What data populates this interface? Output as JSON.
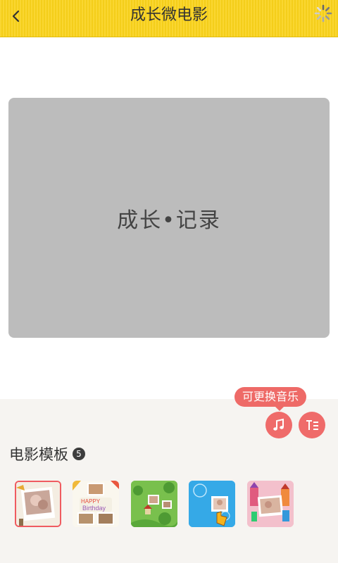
{
  "header": {
    "title": "成长微电影",
    "back_icon": "chevron-left-icon",
    "loading_icon": "spinner-icon",
    "background_color": "#f9d21a"
  },
  "preview": {
    "text": "成长•记录",
    "background_color": "#bcbcbc"
  },
  "controls": {
    "tooltip_text": "可更换音乐",
    "music_icon": "music-note-icon",
    "text_icon": "text-format-icon",
    "accent_color": "#ef6b6a"
  },
  "templates": {
    "title": "电影模板",
    "count": "5",
    "items": [
      {
        "name": "template-baby-photo",
        "selected": true
      },
      {
        "name": "template-happy-birthday",
        "selected": false
      },
      {
        "name": "template-green-forest",
        "selected": false
      },
      {
        "name": "template-blue-bubble",
        "selected": false
      },
      {
        "name": "template-pink-castle",
        "selected": false
      }
    ]
  }
}
